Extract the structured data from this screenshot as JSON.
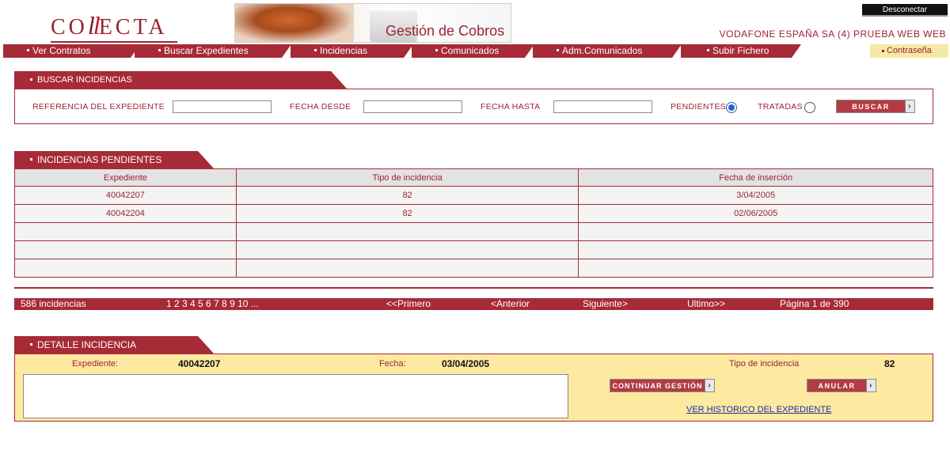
{
  "header": {
    "logo": "COLLECTA",
    "banner_title": "Gestión de Cobros",
    "disconnect_label": "Desconectar",
    "company": "VODAFONE ESPAÑA SA (4) PRUEBA WEB WEB"
  },
  "nav": {
    "items": [
      "Ver Contratos",
      "Buscar Expedientes",
      "Incidencias",
      "Comunicados",
      "Adm.Comunicados",
      "Subir Fichero"
    ],
    "password_label": "Contraseña"
  },
  "search": {
    "tab_title": "BUSCAR INCIDENCIAS",
    "ref_label": "REFERENCIA DEL EXPEDIENTE",
    "ref_value": "",
    "from_label": "FECHA DESDE",
    "from_value": "",
    "to_label": "FECHA HASTA",
    "to_value": "",
    "pending_label": "PENDIENTES",
    "treated_label": "TRATADAS",
    "selected": "PENDIENTES",
    "search_button": "BUSCAR"
  },
  "table": {
    "tab_title": "INCIDENCIAS PENDIENTES",
    "columns": [
      "Expediente",
      "Tipo de incidencia",
      "Fecha de inserción"
    ],
    "rows": [
      [
        "40042207",
        "82",
        "3/04/2005"
      ],
      [
        "40042204",
        "82",
        "02/06/2005"
      ],
      [
        "",
        "",
        ""
      ],
      [
        "",
        "",
        ""
      ],
      [
        "",
        "",
        ""
      ]
    ]
  },
  "pager": {
    "count": "586 incidencias",
    "pages": "1 2 3 4 5 6 7 8 9 10 ...",
    "first": "<<Primero",
    "prev": "<Anterior",
    "next": "Siguiente>",
    "last": "Ultimo>>",
    "page_info": "Página 1 de 390"
  },
  "detail": {
    "tab_title": "DETALLE INCIDENCIA",
    "expediente_label": "Expediente:",
    "expediente_value": "40042207",
    "fecha_label": "Fecha:",
    "fecha_value": "03/04/2005",
    "tipo_label": "Tipo de incidencia",
    "tipo_value": "82",
    "text_value": "",
    "continue_button": "CONTINUAR GESTIÓN",
    "cancel_button": "ANULAR",
    "history_link": "VER HISTORICO DEL EXPEDIENTE"
  },
  "colors": {
    "brand": "#a72a37",
    "detail_bg": "#fde9a0",
    "link": "#1b2fa8"
  },
  "icons": {
    "bullet": "square-bullet-icon",
    "button_arrow": "chevron-right-icon",
    "radio_selected": "radio-selected-icon"
  }
}
